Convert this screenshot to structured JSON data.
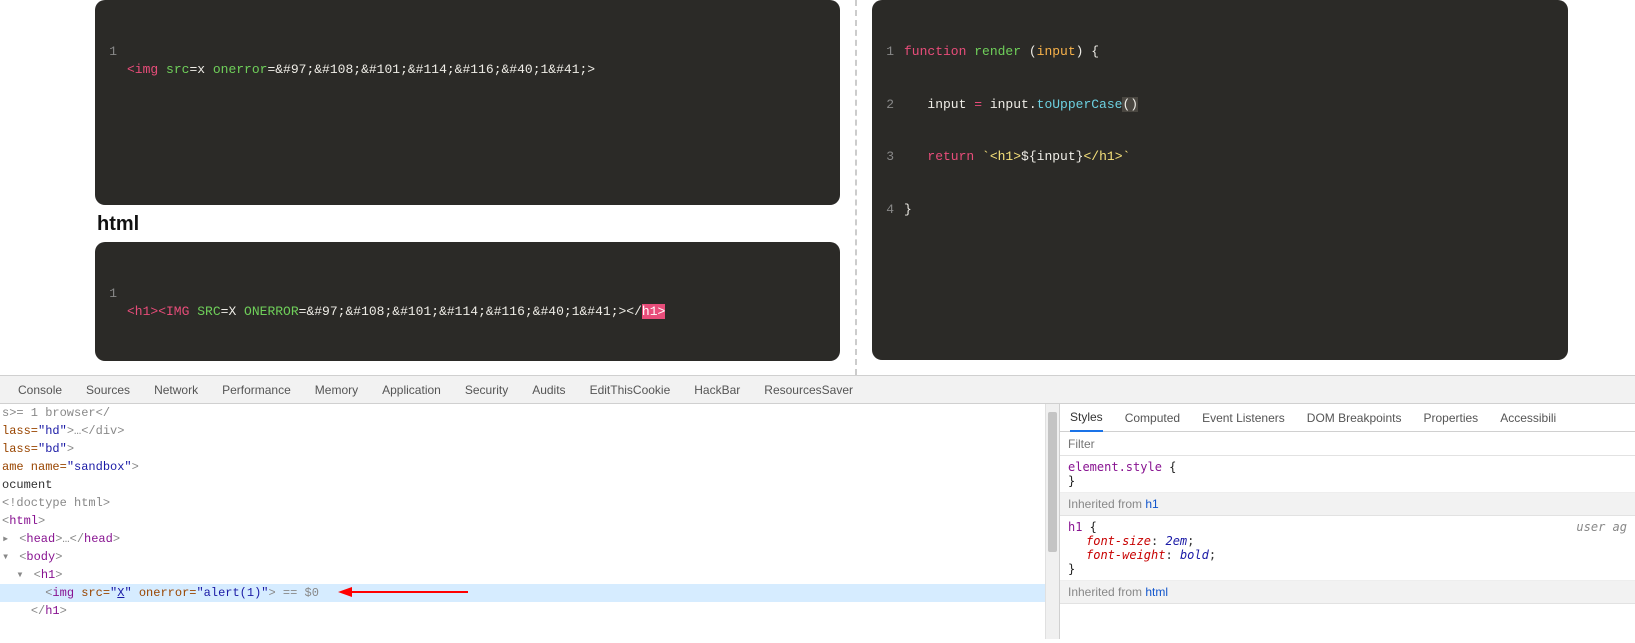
{
  "left": {
    "editor1": {
      "line1_num": "1",
      "tag_open": "<img",
      "sp1": " ",
      "attr_src": "src",
      "eq_x": "=x ",
      "attr_onerror": "onerror",
      "payload": "=&#97;&#108;&#101;&#114;&#116;&#40;1&#41;>"
    },
    "section_label": "html",
    "editor2": {
      "line1_num": "1",
      "open_h1": "<h1><IMG",
      "sp1": " ",
      "attr_src": "SRC",
      "eq_x": "=X ",
      "attr_onerror": "ONERROR",
      "payload": "=&#97;&#108;&#101;&#114;&#116;&#40;1&#41;></",
      "close_hl": "h1>"
    }
  },
  "right": {
    "editor": {
      "l1_num": "1",
      "l1_kw": "function",
      "l1_fn": " render ",
      "l1_paren_open": "(",
      "l1_param": "input",
      "l1_rest": ") {",
      "l2_num": "2",
      "l2_indent": "   ",
      "l2_lhs": "input ",
      "l2_eq": "= ",
      "l2_obj": "input.",
      "l2_call": "toUpperCase",
      "l2_paren": "()",
      "l3_num": "3",
      "l3_indent": "   ",
      "l3_kw": "return",
      "l3_sp": " ",
      "l3_tmpl_a": "`<h1>",
      "l3_interp_open": "${",
      "l3_interp_var": "input",
      "l3_interp_close": "}",
      "l3_tmpl_b": "</h1>`",
      "l4_num": "4",
      "l4_brace": "}"
    }
  },
  "devtools": {
    "tabs1": [
      "Console",
      "Sources",
      "Network",
      "Performance",
      "Memory",
      "Application",
      "Security",
      "Audits",
      "EditThisCookie",
      "HackBar",
      "ResourcesSaver"
    ],
    "tabs2": [
      "Styles",
      "Computed",
      "Event Listeners",
      "DOM Breakpoints",
      "Properties",
      "Accessibili"
    ],
    "filter_placeholder": "Filter",
    "rules": {
      "element_style_sel": "element.style",
      "element_style_open": " {",
      "element_style_close": "}",
      "inherit1_prefix": "Inherited from ",
      "inherit1_tag": "h1",
      "h1_sel": "h1",
      "h1_open": " {",
      "h1_p1_name": "font-size",
      "h1_p1_val": "2em",
      "h1_p2_name": "font-weight",
      "h1_p2_val": "bold",
      "h1_close": "}",
      "h1_origin": "user ag",
      "inherit2_prefix": "Inherited from ",
      "inherit2_tag": "html"
    },
    "elements": {
      "l1": "s>= 1 browser</",
      "l2_pre": "lass=",
      "l2_val": "\"hd\"",
      "l2_post": ">…</div>",
      "l3_pre": "lass=",
      "l3_val": "\"bd\"",
      "l3_post": ">",
      "l4_pre": "ame name=",
      "l4_val": "\"sandbox\"",
      "l4_post": ">",
      "l5": "ocument",
      "l6": "<!doctype html>",
      "l7": "<html>",
      "l8a": "<head>",
      "l8b": "…",
      "l8c": "</head>",
      "l9": "<body>",
      "l10": "<h1>",
      "l11_open": "<img",
      "l11_src_a": " src=",
      "l11_src_v": "\"X\"",
      "l11_err_a": " onerror=",
      "l11_err_v": "\"alert(1)\"",
      "l11_close": ">",
      "l11_eq0": " == $0",
      "l12": "</h1>"
    }
  }
}
